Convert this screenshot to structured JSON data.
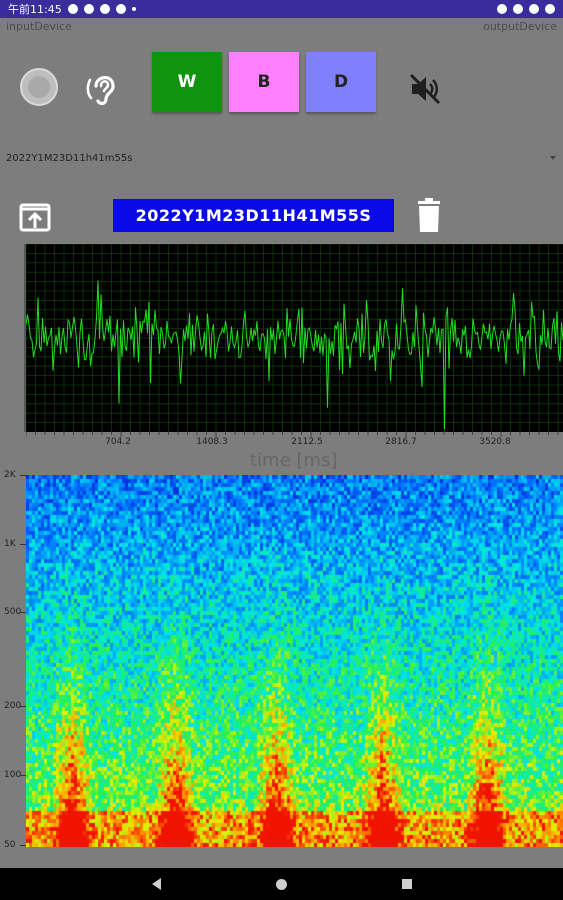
{
  "status_bar": {
    "time": "午前11:45"
  },
  "devices": {
    "input": "inputDevice",
    "output": "outputDevice"
  },
  "mode_buttons": [
    {
      "label": "W"
    },
    {
      "label": "B"
    },
    {
      "label": "D"
    }
  ],
  "recording_select": {
    "selected": "2022Y1M23D11h41m55s"
  },
  "file": {
    "name": "2022Y1M23D11H41M55S"
  },
  "waveform": {
    "x_ticks": [
      "704.2",
      "1408.3",
      "2112.5",
      "2816.7",
      "3520.8"
    ],
    "x_axis_label": "time [ms]",
    "line_color": "#22dd22"
  },
  "spectrogram": {
    "y_ticks": [
      "2K",
      "1K",
      "500",
      "200",
      "100",
      "50"
    ]
  },
  "colors": {
    "status_bar": "#3a2c9a",
    "filename_bg": "#0a0ae8",
    "btn_w": "#109410",
    "btn_b": "#ff80ff",
    "btn_d": "#8080ff"
  }
}
